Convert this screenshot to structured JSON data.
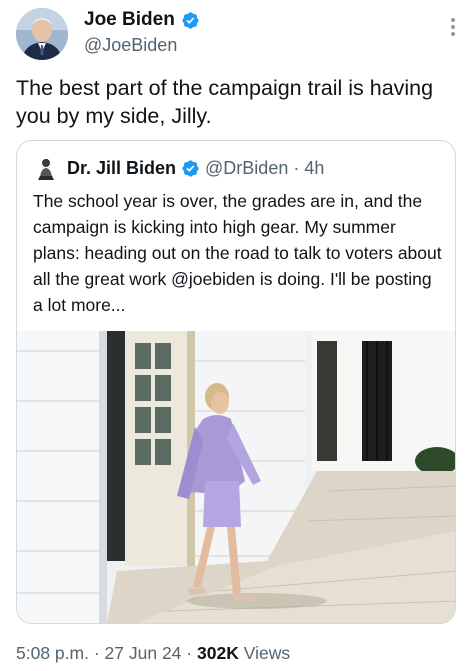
{
  "author": {
    "name": "Joe Biden",
    "handle": "@JoeBiden",
    "verified": true,
    "avatar_icon": "profile-photo"
  },
  "tweet": {
    "text": "The best part of the campaign trail is having you by my side, Jilly."
  },
  "quoted": {
    "name": "Dr. Jill Biden",
    "handle": "@DrBiden",
    "separator": "·",
    "time": "4h",
    "text": "The school year is over, the grades are in, and the campaign is kicking into high gear. My summer plans: heading out on the road to talk to voters about all the great work @joebiden is doing. I'll be posting a lot more...",
    "image": "photo-woman-in-lavender-suit-walking-outside-white-building"
  },
  "footer": {
    "time": "5:08 p.m.",
    "sep1": "·",
    "date": "27 Jun 24",
    "sep2": "·",
    "views_count": "302K",
    "views_label": "Views"
  },
  "colors": {
    "text": "#0f1419",
    "secondary": "#536471",
    "verified": "#1d9bf0",
    "border": "#cfd9de"
  }
}
